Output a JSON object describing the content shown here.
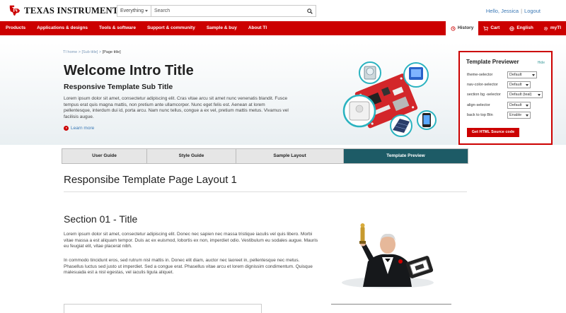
{
  "brand": {
    "name_prefix": "T",
    "name_word1": "EXAS",
    "name_word2": "NSTRUMENTS",
    "name_prefix2": "I",
    "color": "#cc0000"
  },
  "search": {
    "scope_value": "Everything",
    "placeholder": "Search",
    "icon": "search-icon"
  },
  "user": {
    "greeting": "Hello, Jessica",
    "separator": "|",
    "logout_label": "Logout"
  },
  "nav": {
    "items": [
      {
        "label": "Products"
      },
      {
        "label": "Applications & designs"
      },
      {
        "label": "Tools & software"
      },
      {
        "label": "Support & community"
      },
      {
        "label": "Sample & buy"
      },
      {
        "label": "About TI"
      }
    ],
    "right": [
      {
        "label": "History",
        "icon": "history-icon"
      },
      {
        "label": "Cart",
        "icon": "cart-icon"
      },
      {
        "label": "English",
        "icon": "globe-icon"
      },
      {
        "label": "myTI",
        "icon": "gear-icon"
      }
    ]
  },
  "hero": {
    "breadcrumb": {
      "home": "TI home",
      "sep1": " > ",
      "sub": "[Sub title]",
      "sep2": " > ",
      "current": "[Page title]"
    },
    "title": "Welcome Intro Title",
    "subtitle": "Responsive Template Sub Title",
    "body": "Lorem ipsum dolor sit amet, consectetur adipiscing elit. Cras vitae arcu sit amet nunc venenatis blandit. Fusce tempus erat quis magna mattis, non pretium ante ullamcorper. Nunc eget felis est. Aenean at lorem pellentesque, interdum dui id, porta arcu. Nam nunc tellus, congue a ex vel, pretium mattis metus. Vivamus vel facilisis augue.",
    "learn_more": "Learn more"
  },
  "previewer": {
    "title": "Template Previewer",
    "hide": "Hide",
    "rows": [
      {
        "label": "theme-selector",
        "value": "Default"
      },
      {
        "label": "nav-color-selector",
        "value": "Default"
      },
      {
        "label": "section bg -selector",
        "value": "Default (teal)"
      },
      {
        "label": "align-selector",
        "value": "Default"
      },
      {
        "label": "back to top Btn",
        "value": "Enable"
      }
    ],
    "button": "Get HTML Source code"
  },
  "tabs": [
    {
      "label": "User Guide",
      "active": false
    },
    {
      "label": "Style Guide",
      "active": false
    },
    {
      "label": "Sample Layout",
      "active": false
    },
    {
      "label": "Template Preview",
      "active": true
    }
  ],
  "page": {
    "heading": "Responsibe Template Page Layout 1",
    "section_title": "Section 01 - Title",
    "p1": "Lorem ipsum dolor sit amet, consectetur adipiscing elit. Donec nec sapien nec massa tristique iaculis vel quis libero. Morbi vitae massa a est aliquam tempor. Duis ac ex euismod, lobortis ex non, imperdiet odio. Vestibulum eu sodales augue. Mauris eu feugiat elit, vitae placerat nibh.",
    "p2": "In commodo tincidunt eros, sed rutrum nisl mattis in. Donec elit diam, auctor nec laoreet in, pellentesque nec metus. Phasellus luctus sed justo ut imperdiet. Sed a congue erat. Phasellus vitae arcu et lorem dignissim condimentum. Quisque malesuada est a nisl egestas, vel iaculis ligula aliquet."
  },
  "colors": {
    "accent_red": "#cc0000",
    "teal": "#1d5b66",
    "link": "#3a78b5"
  }
}
